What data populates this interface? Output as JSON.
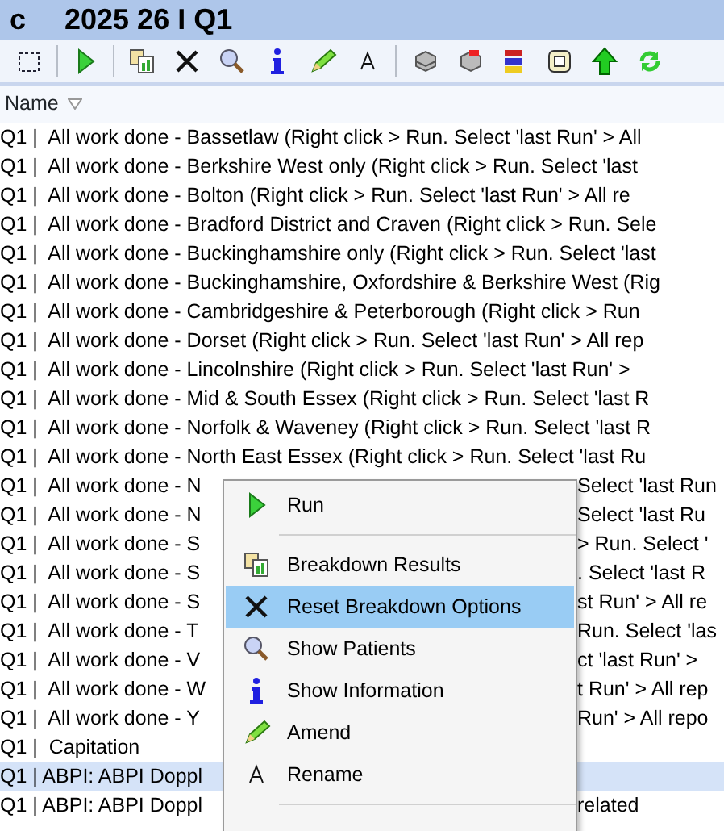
{
  "window": {
    "title_prefix": "c",
    "title": "2025 26 I Q1"
  },
  "list": {
    "column": "Name",
    "rows": [
      {
        "text": "Q1 |  All work done - Bassetlaw (Right click > Run. Select 'last Run' > All",
        "selected": false
      },
      {
        "text": "Q1 |  All work done - Berkshire West only (Right click > Run. Select 'last",
        "selected": false
      },
      {
        "text": "Q1 |  All work done - Bolton (Right click > Run. Select 'last Run' > All re",
        "selected": false
      },
      {
        "text": "Q1 |  All work done - Bradford District and Craven (Right click > Run. Sele",
        "selected": false
      },
      {
        "text": "Q1 |  All work done - Buckinghamshire only (Right click > Run. Select 'last",
        "selected": false
      },
      {
        "text": "Q1 |  All work done - Buckinghamshire, Oxfordshire & Berkshire West (Rig",
        "selected": false
      },
      {
        "text": "Q1 |  All work done - Cambridgeshire & Peterborough (Right click > Run",
        "selected": false
      },
      {
        "text": "Q1 |  All work done - Dorset (Right click > Run. Select 'last Run' > All rep",
        "selected": false
      },
      {
        "text": "Q1 |  All work done - Lincolnshire (Right click > Run. Select 'last Run' >",
        "selected": false
      },
      {
        "text": "Q1 |  All work done - Mid & South Essex (Right click > Run. Select 'last R",
        "selected": false
      },
      {
        "text": "Q1 |  All work done - Norfolk & Waveney (Right click > Run. Select 'last R",
        "selected": false
      },
      {
        "text": "Q1 |  All work done - North East Essex (Right click > Run. Select 'last Ru",
        "selected": false
      },
      {
        "text": "Q1 |  All work done - N",
        "covered_text": "Select 'last Run",
        "selected": false
      },
      {
        "text": "Q1 |  All work done - N",
        "covered_text": "Select 'last Ru",
        "selected": false
      },
      {
        "text": "Q1 |  All work done - S",
        "covered_text": "> Run. Select '",
        "selected": false
      },
      {
        "text": "Q1 |  All work done - S",
        "covered_text": ". Select 'last R",
        "selected": false
      },
      {
        "text": "Q1 |  All work done - S",
        "covered_text": "st Run' > All re",
        "selected": false
      },
      {
        "text": "Q1 |  All work done - T",
        "covered_text": "Run. Select 'las",
        "selected": false
      },
      {
        "text": "Q1 |  All work done - V",
        "covered_text": "ct 'last Run' >",
        "selected": false
      },
      {
        "text": "Q1 |  All work done - W",
        "covered_text": "t Run' > All rep",
        "selected": false
      },
      {
        "text": "Q1 |  All work done - Y",
        "covered_text": "Run' > All repo",
        "selected": false
      },
      {
        "text": "Q1 |  Capitation",
        "selected": false
      },
      {
        "text": "Q1 | ABPI: ABPI Doppl",
        "selected": true
      },
      {
        "text": "Q1 | ABPI: ABPI Doppl",
        "covered_text": "related",
        "selected": false
      }
    ]
  },
  "context_menu": {
    "items": [
      {
        "kind": "run",
        "label": "Run",
        "selected": false
      },
      {
        "kind": "separator"
      },
      {
        "kind": "breakdown",
        "label": "Breakdown Results",
        "selected": false
      },
      {
        "kind": "reset",
        "label": "Reset Breakdown Options",
        "selected": true
      },
      {
        "kind": "patients",
        "label": "Show Patients",
        "selected": false
      },
      {
        "kind": "info",
        "label": "Show Information",
        "selected": false
      },
      {
        "kind": "amend",
        "label": "Amend",
        "selected": false
      },
      {
        "kind": "rename",
        "label": "Rename",
        "selected": false
      },
      {
        "kind": "separator"
      }
    ]
  }
}
